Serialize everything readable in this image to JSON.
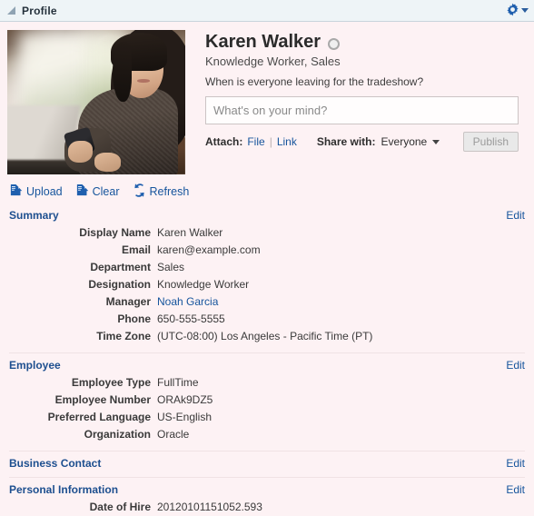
{
  "titlebar": {
    "title": "Profile",
    "collapse_icon": "collapse-triangle-icon",
    "gear_icon": "gear-icon",
    "caret_icon": "chevron-down-icon"
  },
  "profile": {
    "photo_alt": "woman-at-laptop-with-phone",
    "name": "Karen Walker",
    "presence": "offline",
    "role": "Knowledge Worker, Sales",
    "status_message": "When is everyone leaving for the tradeshow?"
  },
  "publisher": {
    "placeholder": "What's on your mind?",
    "value": "",
    "attach_label": "Attach:",
    "attach_file": "File",
    "attach_link": "Link",
    "share_label": "Share with:",
    "share_value": "Everyone",
    "publish_label": "Publish"
  },
  "actions": [
    {
      "label": "Upload",
      "icon": "upload-document-icon"
    },
    {
      "label": "Clear",
      "icon": "clear-document-icon"
    },
    {
      "label": "Refresh",
      "icon": "refresh-icon"
    }
  ],
  "sections": [
    {
      "title": "Summary",
      "edit_label": "Edit",
      "fields": [
        {
          "label": "Display Name",
          "value": "Karen Walker",
          "is_link": false
        },
        {
          "label": "Email",
          "value": "karen@example.com",
          "is_link": false
        },
        {
          "label": "Department",
          "value": "Sales",
          "is_link": false
        },
        {
          "label": "Designation",
          "value": "Knowledge Worker",
          "is_link": false
        },
        {
          "label": "Manager",
          "value": "Noah Garcia",
          "is_link": true
        },
        {
          "label": "Phone",
          "value": "650-555-5555",
          "is_link": false
        },
        {
          "label": "Time Zone",
          "value": "(UTC-08:00) Los Angeles - Pacific Time (PT)",
          "is_link": false
        }
      ]
    },
    {
      "title": "Employee",
      "edit_label": "Edit",
      "fields": [
        {
          "label": "Employee Type",
          "value": "FullTime",
          "is_link": false
        },
        {
          "label": "Employee Number",
          "value": "ORAk9DZ5",
          "is_link": false
        },
        {
          "label": "Preferred Language",
          "value": "US-English",
          "is_link": false
        },
        {
          "label": "Organization",
          "value": "Oracle",
          "is_link": false
        }
      ]
    },
    {
      "title": "Business Contact",
      "edit_label": "Edit",
      "fields": []
    },
    {
      "title": "Personal Information",
      "edit_label": "Edit",
      "fields": [
        {
          "label": "Date of Hire",
          "value": "20120101151052.593",
          "is_link": false
        }
      ]
    }
  ],
  "colors": {
    "page_background": "#fdf2f4",
    "titlebar_background": "#eef4f7",
    "link": "#15549c",
    "section_title": "#1d4f8f",
    "icon_blue": "#1f5fae"
  }
}
